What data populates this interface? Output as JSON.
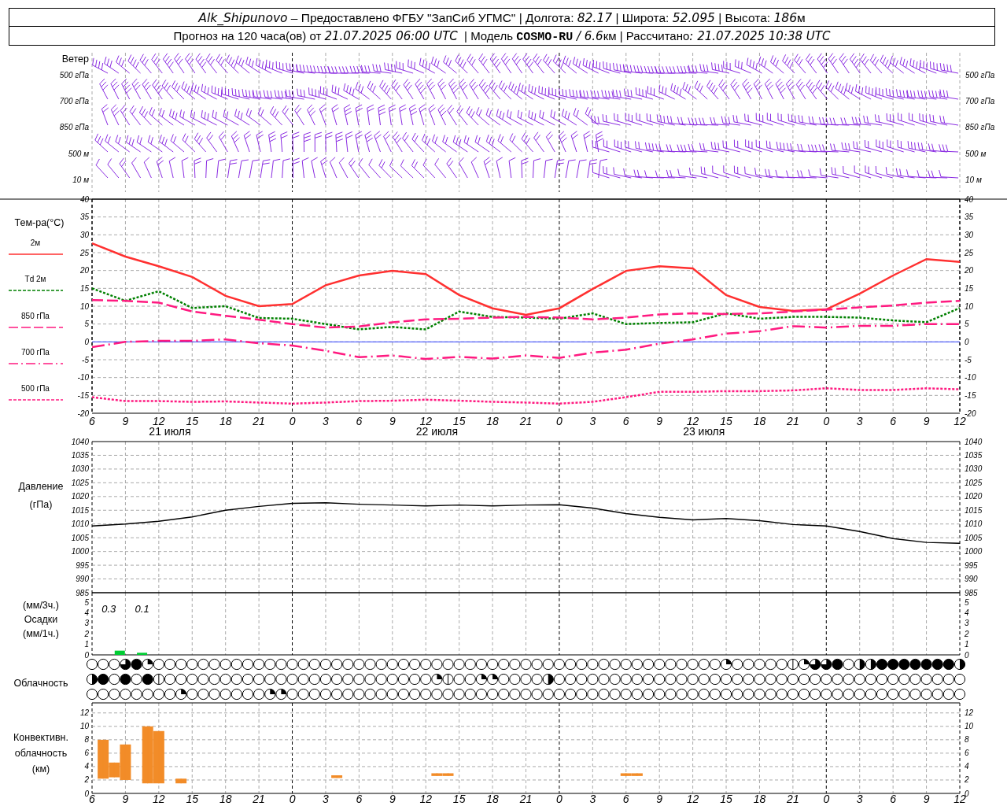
{
  "header": {
    "station": [
      {
        "text": "Alk_Shipunovo",
        "kind": "italic"
      },
      {
        "text": " – Предоставлено ФГБУ \"ЗапСиб УГМС\" | Долгота: ",
        "kind": "plain"
      },
      {
        "text": "82.17",
        "kind": "italic"
      },
      {
        "text": " | Широта: ",
        "kind": "plain"
      },
      {
        "text": "52.095",
        "kind": "italic"
      },
      {
        "text": " | Высота: ",
        "kind": "plain"
      },
      {
        "text": "186",
        "kind": "italic"
      },
      {
        "text": "м",
        "kind": "plain"
      }
    ],
    "forecast": [
      {
        "text": "Прогноз на 120 часа(ов) от ",
        "kind": "plain"
      },
      {
        "text": "21.07.2025 06:00 UTC",
        "kind": "italic"
      },
      {
        "text": "  | Модель ",
        "kind": "plain"
      },
      {
        "text": "COSMO-RU",
        "kind": "bold"
      },
      {
        "text": " / 6.6",
        "kind": "italic"
      },
      {
        "text": "км | Рассчитано",
        "kind": "plain"
      },
      {
        "text": ": 21.07.2025 10:38 UTC",
        "kind": "italic"
      }
    ]
  },
  "wind": {
    "title": "Ветер",
    "levels": [
      {
        "label": "500 гПа",
        "label_right": "500 гПа"
      },
      {
        "label": "700 гПа",
        "label_right": "700 гПа"
      },
      {
        "label": "850 гПа",
        "label_right": "850 гПа"
      },
      {
        "label": "500 м",
        "label_right": "500 м"
      },
      {
        "label": "10  м",
        "label_right": "10  м"
      }
    ]
  },
  "temperature": {
    "title": "Тем-ра(°C)",
    "date_labels": [
      "21 июля",
      "22 июля",
      "23 июля"
    ],
    "right_axis_labels": [
      "40",
      "35",
      "30",
      "25",
      "20",
      "15",
      "10",
      "5",
      "0",
      "-5",
      "-10",
      "-15",
      "-20"
    ],
    "chart_data": {
      "type": "line",
      "ylim": [
        -20,
        40
      ],
      "yticks": [
        40,
        35,
        30,
        25,
        20,
        15,
        10,
        5,
        0,
        -5,
        -10,
        -15,
        -20
      ],
      "grid": true,
      "categories": [
        "6",
        "9",
        "12",
        "15",
        "18",
        "21",
        "0",
        "3",
        "6",
        "9",
        "12",
        "15",
        "18",
        "21",
        "0",
        "3",
        "6",
        "9",
        "12",
        "15",
        "18",
        "21",
        "0",
        "3",
        "6",
        "9",
        "12"
      ],
      "ref_lines": [
        {
          "axis": "y",
          "value": 0,
          "color": "#3344ff"
        }
      ],
      "series": [
        {
          "name": "2м",
          "line_style": "solid",
          "color": "#ff3030",
          "values": [
            27.6,
            23.9,
            21.2,
            18.2,
            12.9,
            10,
            10.6,
            15.9,
            18.6,
            19.9,
            19,
            13.1,
            9.4,
            7.6,
            9.4,
            14.8,
            19.9,
            21.2,
            20.6,
            13.1,
            9.8,
            8.7,
            9.1,
            13.5,
            18.6,
            23.2,
            22.4
          ]
        },
        {
          "name": "Td  2м",
          "line_style": "dotted",
          "color": "#008000",
          "values": [
            15,
            11.5,
            14.2,
            9.5,
            10,
            6.7,
            6.5,
            5,
            3.5,
            4.2,
            3.5,
            8.5,
            7,
            6.8,
            6.5,
            8,
            5,
            5.3,
            5.5,
            8,
            6.5,
            7,
            7,
            6.8,
            6,
            5.5,
            9.5
          ]
        },
        {
          "name": "850 гПа",
          "line_style": "dashed",
          "color": "#ff1a80",
          "values": [
            11.7,
            11.5,
            11,
            8.5,
            7.3,
            6.2,
            5,
            4,
            4.3,
            5.5,
            6.3,
            6.5,
            6.8,
            7,
            6.8,
            6.3,
            6.8,
            7.7,
            8,
            7.8,
            8,
            8.5,
            9,
            9.7,
            10.2,
            11,
            11.5
          ]
        },
        {
          "name": "700 гПа",
          "line_style": "dashdot",
          "color": "#ff1a80",
          "values": [
            -1.5,
            0,
            0.3,
            0.3,
            0.7,
            -0.4,
            -1,
            -2.5,
            -4.3,
            -3.8,
            -4.8,
            -4.2,
            -4.7,
            -3.8,
            -4.5,
            -3,
            -2.2,
            -0.5,
            0.7,
            2.3,
            3,
            4.4,
            4,
            4.5,
            4.5,
            5,
            5
          ]
        },
        {
          "name": "500 гПа",
          "line_style": "dotted",
          "color": "#ff1a80",
          "values": [
            -15.5,
            -16.6,
            -16.6,
            -16.8,
            -16.7,
            -17,
            -17.3,
            -17,
            -16.6,
            -16.5,
            -16.2,
            -16.5,
            -16.8,
            -17,
            -17.3,
            -16.8,
            -15.5,
            -14,
            -14,
            -13.8,
            -13.8,
            -13.6,
            -13,
            -13.5,
            -13.5,
            -13,
            -13.3
          ]
        }
      ]
    }
  },
  "pressure": {
    "title": "Давление",
    "unit": "(гПа)",
    "right_axis_labels": [
      "1040",
      "1035",
      "1030",
      "1025",
      "1020",
      "1015",
      "1010",
      "1005",
      "1000",
      "995",
      "990",
      "985"
    ],
    "chart_data": {
      "type": "line",
      "grid": true,
      "ylim": [
        985,
        1040
      ],
      "yticks": [
        1040,
        1035,
        1030,
        1025,
        1020,
        1015,
        1010,
        1005,
        1000,
        995,
        990,
        985
      ],
      "series": [
        {
          "color": "#000000",
          "values": [
            1009.3,
            1010,
            1011,
            1012.6,
            1015,
            1016.4,
            1017.5,
            1017.7,
            1017.2,
            1016.9,
            1016.6,
            1016.9,
            1016.6,
            1016.9,
            1017,
            1015.8,
            1013.8,
            1012.4,
            1011.5,
            1012,
            1011.2,
            1009.8,
            1009.3,
            1007.3,
            1004.7,
            1003.3,
            1003
          ]
        }
      ]
    }
  },
  "precipitation": {
    "unit_top": "(мм/3ч.)",
    "title": "Осадки",
    "unit_bottom": "(мм/1ч.)",
    "right_axis_labels": [
      "5",
      "4",
      "3",
      "2",
      "1",
      "0"
    ],
    "chart_data": {
      "type": "bar",
      "ylim": [
        0,
        5.896
      ],
      "yticks": [
        5,
        4,
        3,
        2,
        1,
        0
      ],
      "series": [
        {
          "color": "#00cc33",
          "values": [
            null,
            null,
            0.4,
            null,
            0.2,
            null,
            null,
            null,
            null,
            null,
            null,
            null,
            null,
            null,
            null,
            null,
            null,
            null,
            null,
            null,
            null,
            null,
            null,
            null,
            null,
            null,
            null,
            null,
            null,
            null,
            null,
            null,
            null,
            null,
            null,
            null,
            null,
            null,
            null,
            null,
            null,
            null,
            null,
            null,
            null,
            null,
            null,
            null,
            null,
            null,
            null,
            null,
            null,
            null,
            null,
            null,
            null,
            null,
            null,
            null,
            null,
            null,
            null,
            null,
            null,
            null,
            null,
            null,
            null,
            null,
            null,
            null,
            null,
            null,
            null,
            null,
            null,
            null,
            null
          ]
        }
      ],
      "annotations": [
        "0.3",
        "0.1"
      ]
    }
  },
  "cloudiness": {
    "title": "Облачность",
    "rows": [
      {
        "cells": [
          {
            "kind": "clear"
          },
          {
            "kind": "clear"
          },
          {
            "kind": "clear"
          },
          {
            "kind": "three_quarters"
          },
          {
            "kind": "full"
          },
          {
            "kind": "quarter"
          },
          {
            "kind": "clear"
          },
          {
            "kind": "clear"
          },
          {
            "kind": "clear"
          },
          {
            "kind": "clear"
          },
          {
            "kind": "clear"
          },
          {
            "kind": "clear"
          },
          {
            "kind": "clear"
          },
          {
            "kind": "clear"
          },
          {
            "kind": "clear"
          },
          {
            "kind": "clear"
          },
          {
            "kind": "clear"
          },
          {
            "kind": "clear"
          },
          {
            "kind": "clear"
          },
          {
            "kind": "clear"
          },
          {
            "kind": "clear"
          },
          {
            "kind": "clear"
          },
          {
            "kind": "clear"
          },
          {
            "kind": "clear"
          },
          {
            "kind": "clear"
          },
          {
            "kind": "clear"
          },
          {
            "kind": "clear"
          },
          {
            "kind": "clear"
          },
          {
            "kind": "clear"
          },
          {
            "kind": "clear"
          },
          {
            "kind": "clear"
          },
          {
            "kind": "clear"
          },
          {
            "kind": "clear"
          },
          {
            "kind": "clear"
          },
          {
            "kind": "clear"
          },
          {
            "kind": "clear"
          },
          {
            "kind": "clear"
          },
          {
            "kind": "clear"
          },
          {
            "kind": "clear"
          },
          {
            "kind": "clear"
          },
          {
            "kind": "clear"
          },
          {
            "kind": "clear"
          },
          {
            "kind": "clear"
          },
          {
            "kind": "clear"
          },
          {
            "kind": "clear"
          },
          {
            "kind": "clear"
          },
          {
            "kind": "clear"
          },
          {
            "kind": "clear"
          },
          {
            "kind": "clear"
          },
          {
            "kind": "clear"
          },
          {
            "kind": "clear"
          },
          {
            "kind": "clear"
          },
          {
            "kind": "clear"
          },
          {
            "kind": "clear"
          },
          {
            "kind": "clear"
          },
          {
            "kind": "clear"
          },
          {
            "kind": "clear"
          },
          {
            "kind": "quarter"
          },
          {
            "kind": "clear"
          },
          {
            "kind": "clear"
          },
          {
            "kind": "clear"
          },
          {
            "kind": "clear"
          },
          {
            "kind": "clear"
          },
          {
            "kind": "line"
          },
          {
            "kind": "quarter"
          },
          {
            "kind": "three_quarters"
          },
          {
            "kind": "three_quarters"
          },
          {
            "kind": "full"
          },
          {
            "kind": "clear"
          },
          {
            "kind": "half"
          },
          {
            "kind": "half"
          },
          {
            "kind": "full"
          },
          {
            "kind": "full"
          },
          {
            "kind": "full"
          },
          {
            "kind": "full"
          },
          {
            "kind": "full"
          },
          {
            "kind": "full"
          },
          {
            "kind": "full"
          },
          {
            "kind": "half"
          }
        ]
      },
      {
        "cells": [
          {
            "kind": "half"
          },
          {
            "kind": "full"
          },
          {
            "kind": "clear"
          },
          {
            "kind": "full"
          },
          {
            "kind": "clear"
          },
          {
            "kind": "full"
          },
          {
            "kind": "line"
          },
          {
            "kind": "clear"
          },
          {
            "kind": "clear"
          },
          {
            "kind": "clear"
          },
          {
            "kind": "clear"
          },
          {
            "kind": "clear"
          },
          {
            "kind": "clear"
          },
          {
            "kind": "clear"
          },
          {
            "kind": "clear"
          },
          {
            "kind": "clear"
          },
          {
            "kind": "clear"
          },
          {
            "kind": "clear"
          },
          {
            "kind": "clear"
          },
          {
            "kind": "clear"
          },
          {
            "kind": "clear"
          },
          {
            "kind": "clear"
          },
          {
            "kind": "clear"
          },
          {
            "kind": "clear"
          },
          {
            "kind": "clear"
          },
          {
            "kind": "clear"
          },
          {
            "kind": "clear"
          },
          {
            "kind": "clear"
          },
          {
            "kind": "clear"
          },
          {
            "kind": "clear"
          },
          {
            "kind": "clear"
          },
          {
            "kind": "quarter"
          },
          {
            "kind": "line"
          },
          {
            "kind": "clear"
          },
          {
            "kind": "clear"
          },
          {
            "kind": "quarter"
          },
          {
            "kind": "quarter"
          },
          {
            "kind": "clear"
          },
          {
            "kind": "clear"
          },
          {
            "kind": "clear"
          },
          {
            "kind": "clear"
          },
          {
            "kind": "half"
          },
          {
            "kind": "clear"
          },
          {
            "kind": "clear"
          },
          {
            "kind": "clear"
          },
          {
            "kind": "clear"
          },
          {
            "kind": "clear"
          },
          {
            "kind": "clear"
          },
          {
            "kind": "clear"
          },
          {
            "kind": "clear"
          },
          {
            "kind": "clear"
          },
          {
            "kind": "clear"
          },
          {
            "kind": "clear"
          },
          {
            "kind": "clear"
          },
          {
            "kind": "clear"
          },
          {
            "kind": "clear"
          },
          {
            "kind": "clear"
          },
          {
            "kind": "clear"
          },
          {
            "kind": "clear"
          },
          {
            "kind": "clear"
          },
          {
            "kind": "clear"
          },
          {
            "kind": "clear"
          },
          {
            "kind": "clear"
          },
          {
            "kind": "clear"
          },
          {
            "kind": "clear"
          },
          {
            "kind": "clear"
          },
          {
            "kind": "clear"
          },
          {
            "kind": "clear"
          },
          {
            "kind": "clear"
          },
          {
            "kind": "clear"
          },
          {
            "kind": "clear"
          },
          {
            "kind": "clear"
          },
          {
            "kind": "clear"
          },
          {
            "kind": "clear"
          },
          {
            "kind": "clear"
          },
          {
            "kind": "clear"
          },
          {
            "kind": "clear"
          },
          {
            "kind": "clear"
          },
          {
            "kind": "clear"
          }
        ]
      },
      {
        "cells": [
          {
            "kind": "clear"
          },
          {
            "kind": "clear"
          },
          {
            "kind": "clear"
          },
          {
            "kind": "clear"
          },
          {
            "kind": "clear"
          },
          {
            "kind": "clear"
          },
          {
            "kind": "clear"
          },
          {
            "kind": "clear"
          },
          {
            "kind": "quarter"
          },
          {
            "kind": "clear"
          },
          {
            "kind": "clear"
          },
          {
            "kind": "clear"
          },
          {
            "kind": "clear"
          },
          {
            "kind": "clear"
          },
          {
            "kind": "clear"
          },
          {
            "kind": "clear"
          },
          {
            "kind": "quarter"
          },
          {
            "kind": "quarter"
          },
          {
            "kind": "clear"
          },
          {
            "kind": "clear"
          },
          {
            "kind": "clear"
          },
          {
            "kind": "clear"
          },
          {
            "kind": "clear"
          },
          {
            "kind": "clear"
          },
          {
            "kind": "clear"
          },
          {
            "kind": "clear"
          },
          {
            "kind": "clear"
          },
          {
            "kind": "clear"
          },
          {
            "kind": "clear"
          },
          {
            "kind": "clear"
          },
          {
            "kind": "clear"
          },
          {
            "kind": "clear"
          },
          {
            "kind": "clear"
          },
          {
            "kind": "clear"
          },
          {
            "kind": "clear"
          },
          {
            "kind": "clear"
          },
          {
            "kind": "clear"
          },
          {
            "kind": "clear"
          },
          {
            "kind": "clear"
          },
          {
            "kind": "clear"
          },
          {
            "kind": "clear"
          },
          {
            "kind": "clear"
          },
          {
            "kind": "clear"
          },
          {
            "kind": "clear"
          },
          {
            "kind": "clear"
          },
          {
            "kind": "clear"
          },
          {
            "kind": "clear"
          },
          {
            "kind": "clear"
          },
          {
            "kind": "clear"
          },
          {
            "kind": "clear"
          },
          {
            "kind": "clear"
          },
          {
            "kind": "clear"
          },
          {
            "kind": "clear"
          },
          {
            "kind": "clear"
          },
          {
            "kind": "clear"
          },
          {
            "kind": "clear"
          },
          {
            "kind": "clear"
          },
          {
            "kind": "clear"
          },
          {
            "kind": "clear"
          },
          {
            "kind": "clear"
          },
          {
            "kind": "clear"
          },
          {
            "kind": "clear"
          },
          {
            "kind": "clear"
          },
          {
            "kind": "clear"
          },
          {
            "kind": "clear"
          },
          {
            "kind": "clear"
          },
          {
            "kind": "clear"
          },
          {
            "kind": "clear"
          },
          {
            "kind": "clear"
          },
          {
            "kind": "clear"
          },
          {
            "kind": "clear"
          },
          {
            "kind": "clear"
          },
          {
            "kind": "clear"
          },
          {
            "kind": "clear"
          },
          {
            "kind": "clear"
          },
          {
            "kind": "clear"
          },
          {
            "kind": "clear"
          },
          {
            "kind": "clear"
          },
          {
            "kind": "clear"
          }
        ]
      }
    ]
  },
  "convective": {
    "title": "Конвективн.",
    "subtitle": "облачность",
    "unit": "(км)",
    "right_axis_labels": [
      "12",
      "10",
      "8",
      "6",
      "4",
      "2",
      "0"
    ],
    "chart_data": {
      "type": "candlestick",
      "grid": true,
      "ylim": [
        0,
        13.5
      ],
      "yticks": [
        12,
        10,
        8,
        6,
        4,
        2,
        0
      ],
      "categories": [
        "6",
        null,
        null,
        "9",
        null,
        null,
        "12",
        null,
        null,
        "15",
        null,
        null,
        "18",
        null,
        null,
        "21",
        null,
        null,
        "0",
        null,
        null,
        "3",
        null,
        null,
        "6",
        null,
        null,
        "9",
        null,
        null,
        "12",
        null,
        null,
        "15",
        null,
        null,
        "18",
        null,
        null,
        "21",
        null,
        null,
        "0",
        null,
        null,
        "3",
        null,
        null,
        "6",
        null,
        null,
        "9",
        null,
        null,
        "12",
        null,
        null,
        "15",
        null,
        null,
        "18",
        null,
        null,
        "21",
        null,
        null,
        "0",
        null,
        null,
        "3",
        null,
        null,
        "6",
        null,
        null,
        "9",
        null,
        null,
        "12"
      ],
      "series": [
        {
          "color": "#f28c28",
          "ohlc": [
            null,
            [
              2.2,
              8.0,
              2.2,
              8.0
            ],
            [
              2.4,
              4.6,
              2.4,
              4.6
            ],
            [
              2.0,
              7.3,
              2.0,
              7.3
            ],
            null,
            [
              1.5,
              10.0,
              1.5,
              10.0
            ],
            [
              1.5,
              9.3,
              1.5,
              9.3
            ],
            null,
            [
              1.5,
              2.2,
              1.5,
              2.2
            ],
            null,
            null,
            null,
            null,
            null,
            null,
            null,
            null,
            null,
            null,
            null,
            null,
            null,
            [
              2.3,
              2.7,
              2.3,
              2.7
            ],
            null,
            null,
            null,
            null,
            null,
            null,
            null,
            null,
            [
              2.6,
              3.0,
              2.6,
              3.0
            ],
            [
              2.6,
              3.0,
              2.6,
              3.0
            ],
            null,
            null,
            null,
            null,
            null,
            null,
            null,
            null,
            null,
            null,
            null,
            null,
            null,
            null,
            null,
            [
              2.6,
              3.0,
              2.6,
              3.0
            ],
            [
              2.6,
              3.0,
              2.6,
              3.0
            ],
            null,
            null,
            null,
            null,
            null,
            null,
            null,
            null,
            null,
            null,
            null,
            null,
            null,
            null,
            null,
            null,
            null,
            null,
            null,
            null,
            null,
            null,
            null,
            null,
            null,
            null,
            null,
            null,
            null
          ]
        }
      ]
    }
  }
}
